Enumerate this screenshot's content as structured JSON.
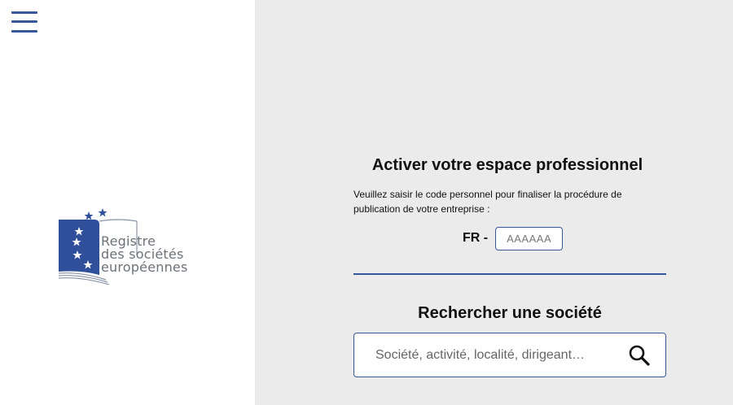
{
  "menu": {
    "icon": "hamburger-menu-icon"
  },
  "logo": {
    "icon": "eu-stars-book-logo-icon",
    "lines": [
      "Registre",
      "des sociétés",
      "européennes"
    ]
  },
  "activate": {
    "title": "Activer votre espace professionnel",
    "description": "Veuillez saisir le code personnel pour finaliser la procédure de publication de votre entreprise :",
    "code_prefix": "FR -",
    "code_placeholder": "AAAAAA",
    "code_value": ""
  },
  "search": {
    "title": "Rechercher une société",
    "placeholder": "Société, activité, localité, dirigeant…",
    "value": "",
    "icon": "search-icon"
  },
  "colors": {
    "accent": "#36589a",
    "panel_background": "#ebebec",
    "logo_blue": "#2f4f9b",
    "logo_text": "#6c7279"
  }
}
